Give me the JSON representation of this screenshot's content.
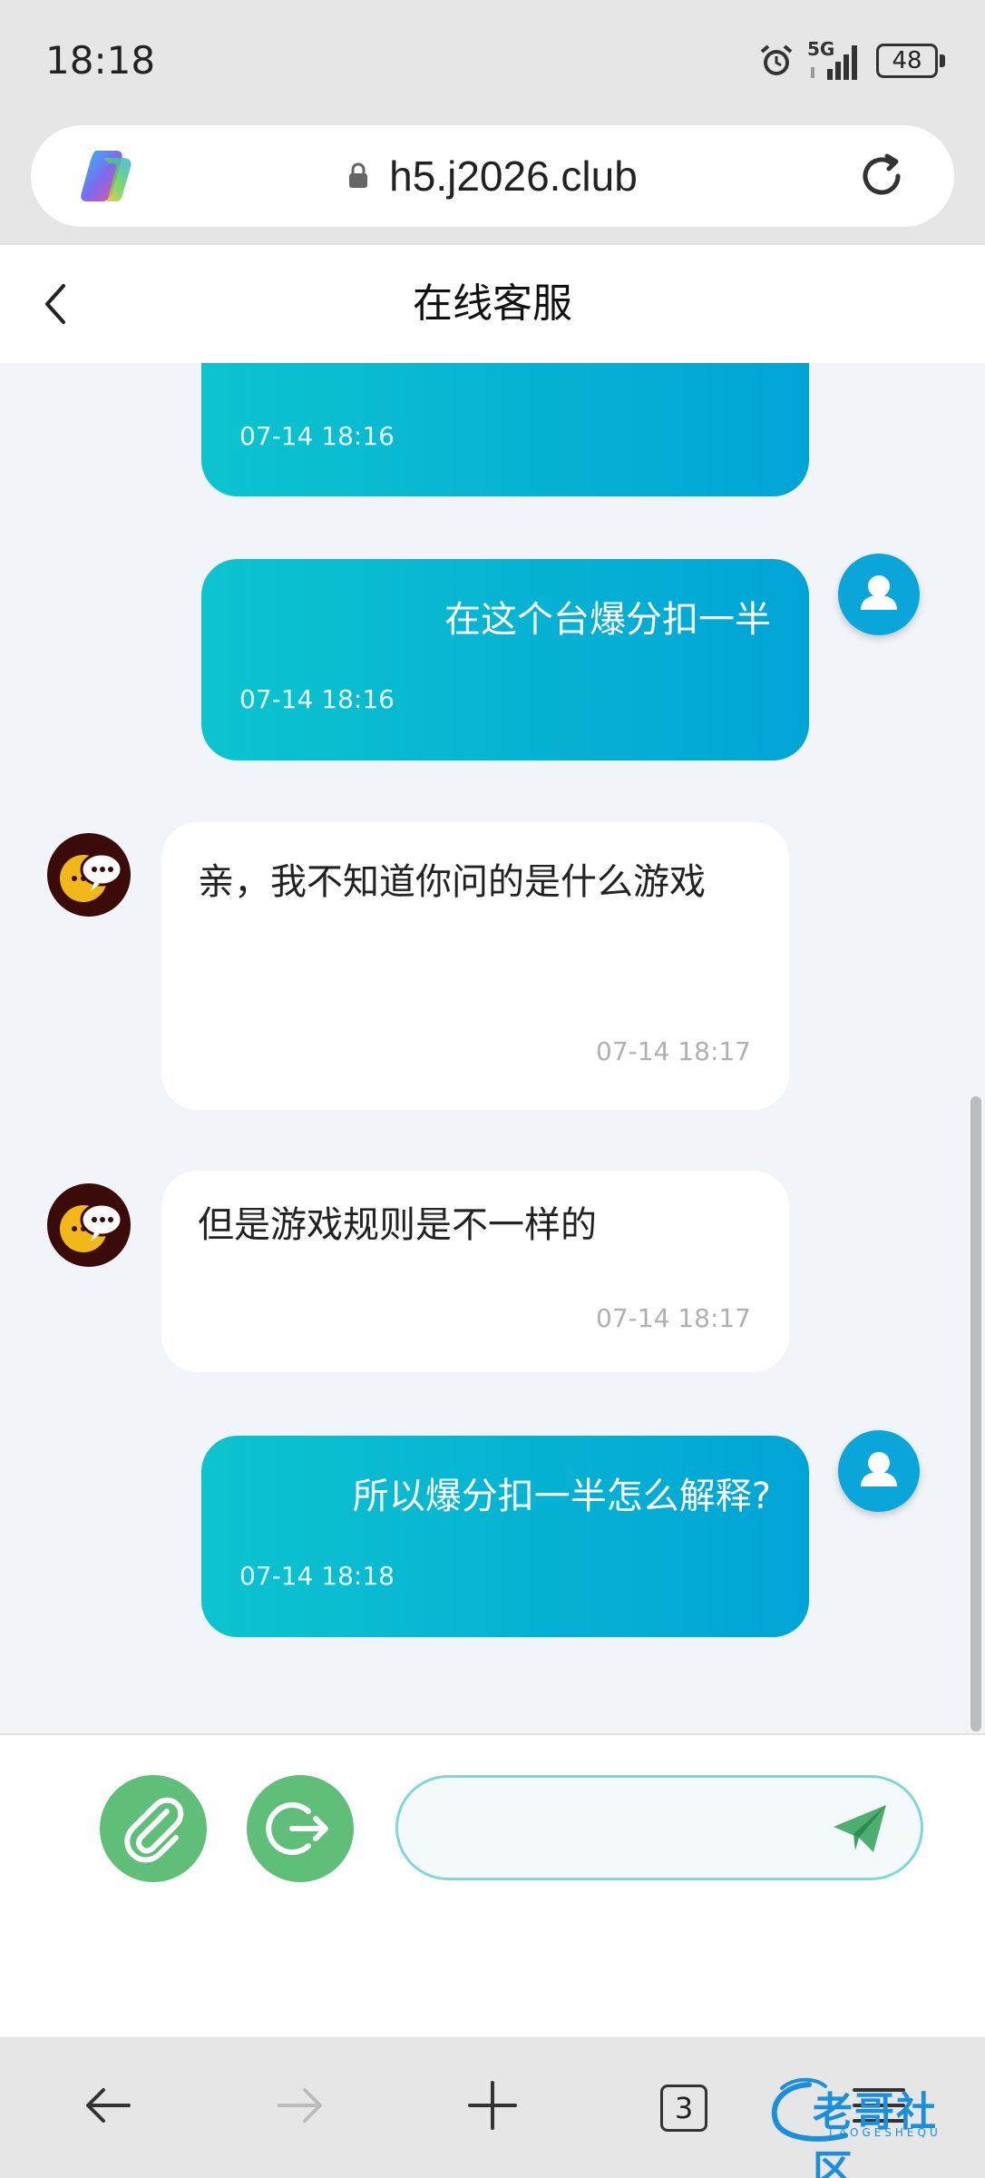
{
  "status_bar": {
    "time": "18:18",
    "network": "5G",
    "battery": "48"
  },
  "browser": {
    "url": "h5.j2026.club",
    "tabs_count": "3"
  },
  "header": {
    "title": "在线客服"
  },
  "messages": [
    {
      "from": "user",
      "text": "",
      "time": "07-14 18:16"
    },
    {
      "from": "user",
      "text": "在这个台爆分扣一半",
      "time": "07-14 18:16"
    },
    {
      "from": "agent",
      "text": "亲，我不知道你问的是什么游戏",
      "time": "07-14 18:17"
    },
    {
      "from": "agent",
      "text": "但是游戏规则是不一样的",
      "time": "07-14 18:17"
    },
    {
      "from": "user",
      "text": "所以爆分扣一半怎么解释?",
      "time": "07-14 18:18"
    }
  ],
  "composer": {
    "placeholder": ""
  },
  "watermark": {
    "text": "老哥社区",
    "sub": "LAOGESHEQU"
  },
  "colors": {
    "accent": "#0cc4cf",
    "accent_end": "#01a4d6",
    "button_green": "#5fbe78",
    "chat_bg": "#f1f4f8"
  },
  "icons": [
    "alarm-icon",
    "signal-icon",
    "battery-icon",
    "copilot-icon",
    "lock-icon",
    "reload-icon",
    "back-arrow-icon",
    "user-avatar-icon",
    "agent-chat-avatar-icon",
    "paperclip-icon",
    "logout-icon",
    "send-icon",
    "nav-back-icon",
    "nav-forward-icon",
    "new-tab-icon",
    "menu-icon"
  ]
}
